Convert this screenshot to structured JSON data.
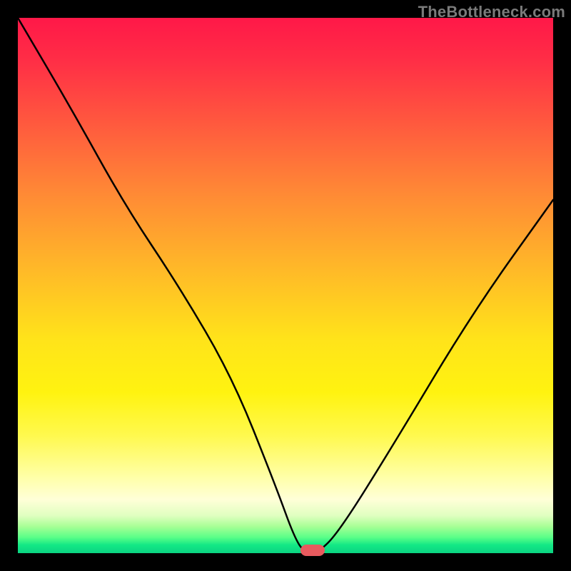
{
  "watermark": "TheBottleneck.com",
  "chart_data": {
    "type": "line",
    "title": "",
    "xlabel": "",
    "ylabel": "",
    "xlim": [
      0,
      100
    ],
    "ylim": [
      0,
      100
    ],
    "series": [
      {
        "name": "bottleneck-curve",
        "x": [
          0,
          10,
          20,
          30,
          40,
          48,
          52,
          54,
          56,
          60,
          70,
          85,
          100
        ],
        "y": [
          100,
          83,
          65,
          50,
          33,
          13,
          2,
          0,
          0,
          4,
          20,
          45,
          66
        ]
      }
    ],
    "marker": {
      "x": 55,
      "y": 0,
      "color": "#e85a5e"
    },
    "gradient_stops": [
      {
        "pct": 0,
        "color": "#ff1848"
      },
      {
        "pct": 8,
        "color": "#ff2e46"
      },
      {
        "pct": 20,
        "color": "#ff5a3e"
      },
      {
        "pct": 33,
        "color": "#ff8a35"
      },
      {
        "pct": 47,
        "color": "#ffb928"
      },
      {
        "pct": 60,
        "color": "#ffe31a"
      },
      {
        "pct": 70,
        "color": "#fff310"
      },
      {
        "pct": 78,
        "color": "#fff94e"
      },
      {
        "pct": 86,
        "color": "#ffffaa"
      },
      {
        "pct": 90,
        "color": "#ffffd8"
      },
      {
        "pct": 93,
        "color": "#e0ffc0"
      },
      {
        "pct": 95,
        "color": "#a8ff96"
      },
      {
        "pct": 97,
        "color": "#5cff88"
      },
      {
        "pct": 98.5,
        "color": "#12e885"
      },
      {
        "pct": 100,
        "color": "#0bd382"
      }
    ]
  }
}
